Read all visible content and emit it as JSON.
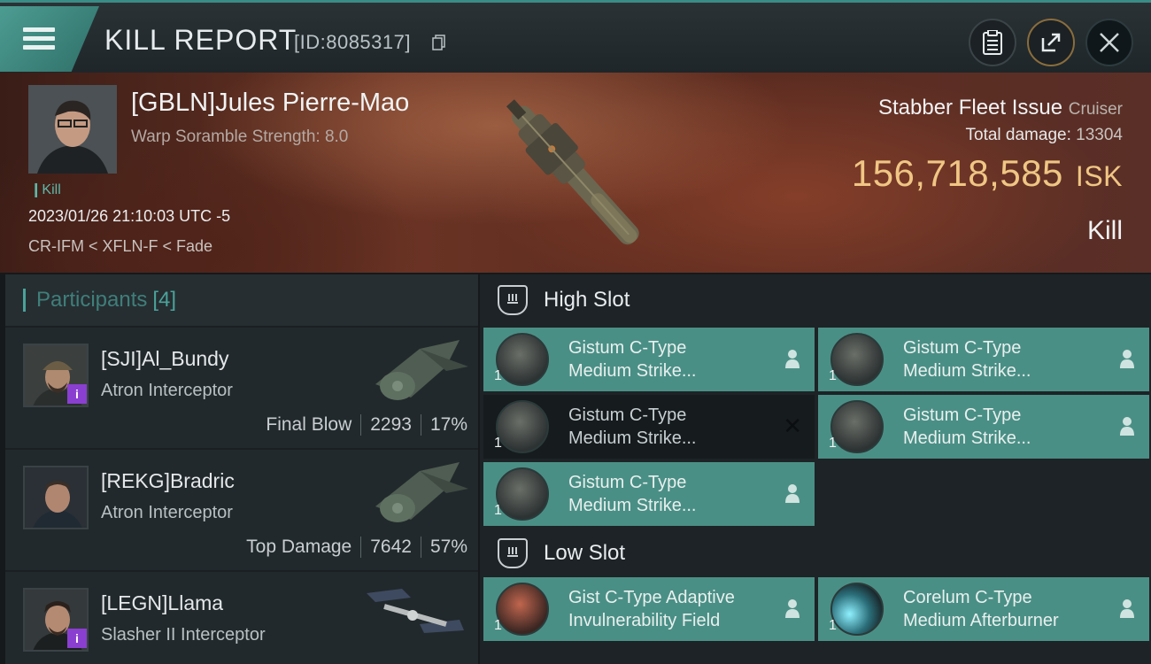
{
  "header": {
    "title": "KILL REPORT",
    "report_id": "[ID:8085317]",
    "icons": [
      "menu-icon",
      "clipboard-icon",
      "share-icon",
      "close-icon"
    ]
  },
  "victim": {
    "name": "[GBLN]Jules Pierre-Mao",
    "subtitle": "Warp Soramble Strength: 8.0",
    "kill_tag": "Kill",
    "datetime": "2023/01/26 21:10:03 UTC -5",
    "location": "CR-IFM < XFLN-F < Fade"
  },
  "ship": {
    "name": "Stabber Fleet Issue",
    "class": "Cruiser",
    "total_damage_label": "Total damage:",
    "total_damage_value": "13304",
    "isk_value": "156,718,585",
    "isk_unit": "ISK",
    "result": "Kill"
  },
  "participants": {
    "label": "Participants",
    "count": "[4]",
    "items": [
      {
        "name": "[SJI]Al_Bundy",
        "ship": "Atron Interceptor",
        "role": "Final Blow",
        "damage": "2293",
        "percent": "17%"
      },
      {
        "name": "[REKG]Bradric",
        "ship": "Atron Interceptor",
        "role": "Top Damage",
        "damage": "7642",
        "percent": "57%"
      },
      {
        "name": "[LEGN]Llama",
        "ship": "Slasher II Interceptor",
        "role": "",
        "damage": "",
        "percent": ""
      }
    ]
  },
  "fitting": {
    "high_slot_label": "High Slot",
    "low_slot_label": "Low Slot",
    "high_modules": [
      {
        "line1": "Gistum C-Type",
        "line2": "Medium Strike...",
        "qty": "1"
      },
      {
        "line1": "Gistum C-Type",
        "line2": "Medium Strike...",
        "qty": "1"
      },
      {
        "line1": "Gistum C-Type",
        "line2": "Medium Strike...",
        "qty": "1"
      },
      {
        "line1": "Gistum C-Type",
        "line2": "Medium Strike...",
        "qty": "1"
      },
      {
        "line1": "Gistum C-Type",
        "line2": "Medium Strike...",
        "qty": "1"
      }
    ],
    "low_modules": [
      {
        "line1": "Gist C-Type Adaptive",
        "line2": "Invulnerability Field",
        "qty": "1"
      },
      {
        "line1": "Corelum C-Type",
        "line2": "Medium Afterburner",
        "qty": "1"
      }
    ]
  },
  "colors": {
    "accent": "#4a8f85",
    "isk": "#f0c684",
    "participant_label": "#3f7f7a"
  }
}
